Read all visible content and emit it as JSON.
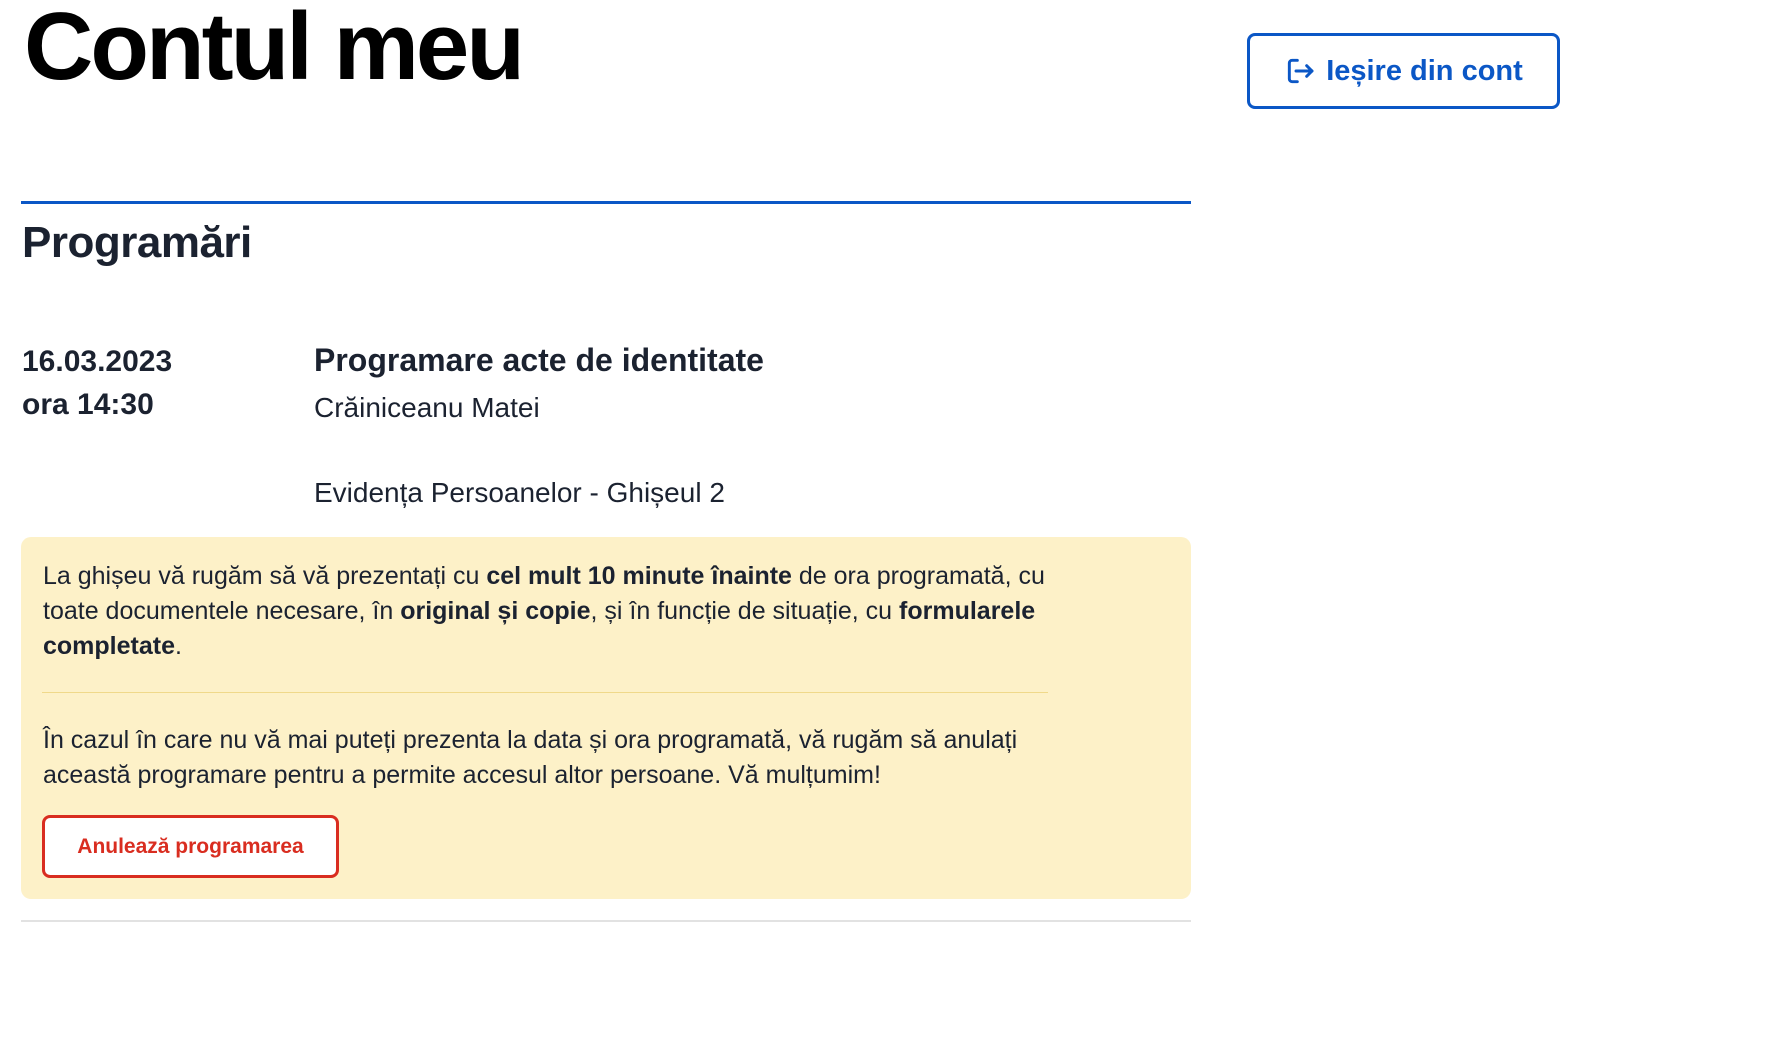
{
  "header": {
    "title": "Contul meu",
    "logout_label": "Ieșire din cont",
    "logout_icon": "logout-icon"
  },
  "appointments": {
    "section_title": "Programări",
    "items": [
      {
        "date": "16.03.2023",
        "time": "ora 14:30",
        "title": "Programare acte de identitate",
        "person": "Crăiniceanu Matei",
        "location": "Evidența Persoanelor - Ghișeul 2",
        "notice": {
          "p1_a": "La ghișeu vă rugăm să vă prezentați cu ",
          "p1_b": "cel mult 10 minute înainte",
          "p1_c": " de ora programată, cu toate documentele necesare, în ",
          "p1_d": "original și copie",
          "p1_e": ", și în funcție de situație, cu ",
          "p1_f": "formularele completate",
          "p1_g": ".",
          "p2": "În cazul în care nu vă mai puteți prezenta la data și ora programată, vă rugăm să anulați această programare pentru a permite accesul altor persoane. Vă mulțumim!",
          "cancel_label": "Anulează programarea"
        }
      }
    ]
  },
  "colors": {
    "primary": "#0b57c6",
    "danger": "#d92d20",
    "notice_bg": "#fdf1c8",
    "text": "#1b2230"
  }
}
